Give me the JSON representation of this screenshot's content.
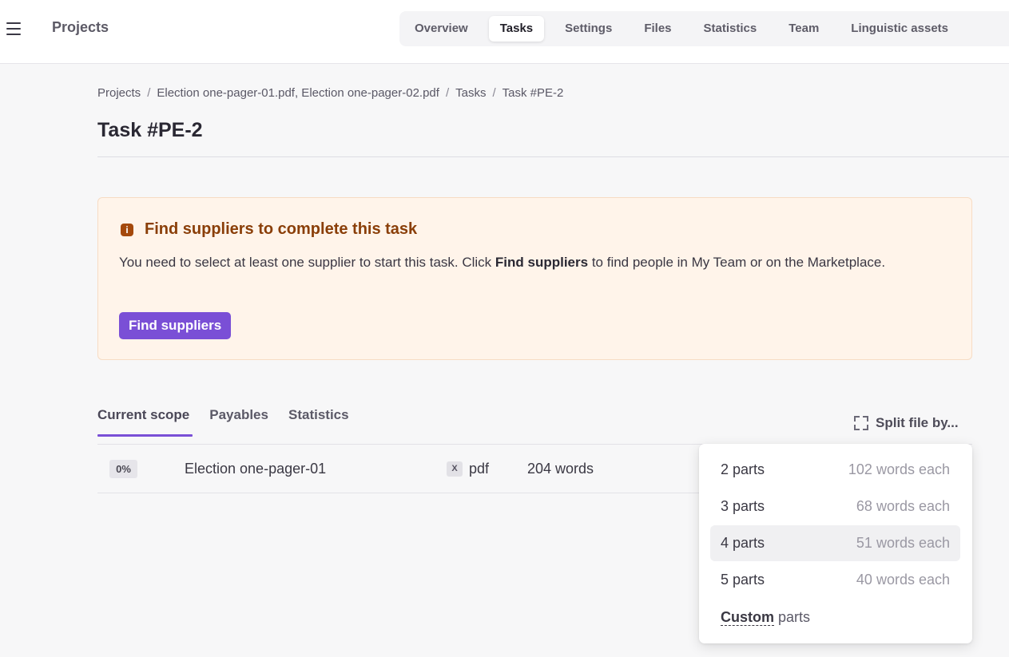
{
  "app": {
    "title": "Projects"
  },
  "topnav": {
    "tabs": [
      {
        "label": "Overview",
        "active": false
      },
      {
        "label": "Tasks",
        "active": true
      },
      {
        "label": "Settings",
        "active": false
      },
      {
        "label": "Files",
        "active": false
      },
      {
        "label": "Statistics",
        "active": false
      },
      {
        "label": "Team",
        "active": false
      },
      {
        "label": "Linguistic assets",
        "active": false
      }
    ]
  },
  "breadcrumb": {
    "items": [
      "Projects",
      "Election one-pager-01.pdf, Election one-pager-02.pdf",
      "Tasks",
      "Task #PE-2"
    ],
    "separator": "/"
  },
  "page": {
    "title": "Task #PE-2"
  },
  "alert": {
    "title": "Find suppliers to complete this task",
    "body_prefix": "You need to select at least one supplier to start this task. Click ",
    "body_bold": "Find suppliers",
    "body_suffix": " to find people in My Team or on the Marketplace.",
    "button": "Find suppliers",
    "icon": "info-icon",
    "accent": "#8a3e08",
    "background": "#fff4ea"
  },
  "subtabs": [
    {
      "label": "Current scope",
      "active": true
    },
    {
      "label": "Payables",
      "active": false
    },
    {
      "label": "Statistics",
      "active": false
    }
  ],
  "split": {
    "label": "Split file by...",
    "icon": "split-icon"
  },
  "file_row": {
    "progress": "0%",
    "name": "Election one-pager-01",
    "type_badge": "X",
    "type": "pdf",
    "words": "204 words"
  },
  "split_menu": {
    "options": [
      {
        "label": "2 parts",
        "each": "102 words each"
      },
      {
        "label": "3 parts",
        "each": "68 words each"
      },
      {
        "label": "4 parts",
        "each": "51 words each",
        "hover": true
      },
      {
        "label": "5 parts",
        "each": "40 words each"
      }
    ],
    "custom_label": "Custom",
    "custom_suffix": "parts"
  },
  "colors": {
    "primary": "#7a4fd6"
  }
}
